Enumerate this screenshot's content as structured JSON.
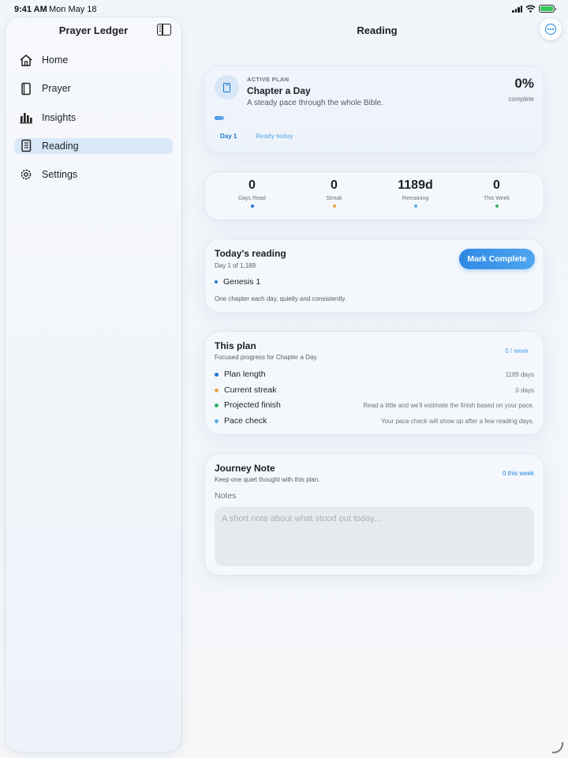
{
  "status_bar": {
    "time": "9:41 AM",
    "date": "Mon May 18"
  },
  "sidebar": {
    "title": "Prayer Ledger",
    "items": [
      {
        "label": "Home",
        "icon": "house-icon",
        "active": false
      },
      {
        "label": "Prayer",
        "icon": "book-icon",
        "active": false
      },
      {
        "label": "Insights",
        "icon": "chart-bars-icon",
        "active": false
      },
      {
        "label": "Reading",
        "icon": "book-pages-icon",
        "active": true
      },
      {
        "label": "Settings",
        "icon": "gear-icon",
        "active": false
      }
    ]
  },
  "header": {
    "title": "Reading"
  },
  "active_plan": {
    "eyebrow": "ACTIVE PLAN",
    "name": "Chapter a Day",
    "description": "A steady pace through the whole Bible.",
    "percent": "0%",
    "percent_label": "complete",
    "progress_fraction": 0,
    "day_chip": "Day 1",
    "ready_chip": "Ready today"
  },
  "stats": [
    {
      "value": "0",
      "label": "Days Read",
      "color": "#1b78d1"
    },
    {
      "value": "0",
      "label": "Streak",
      "color": "#f0a04b"
    },
    {
      "value": "1189d",
      "label": "Remaining",
      "color": "#5ab0e8"
    },
    {
      "value": "0",
      "label": "This Week",
      "color": "#34b36b"
    }
  ],
  "today": {
    "title": "Today's reading",
    "subtitle": "Day 1 of 1,189",
    "button": "Mark Complete",
    "passage": "Genesis 1",
    "note": "One chapter each day, quietly and consistently."
  },
  "this_plan": {
    "title": "This plan",
    "subtitle": "Focused progress for Chapter a Day.",
    "badge": "0 / week",
    "rows": [
      {
        "label": "Plan length",
        "value": "1189 days",
        "color": "#1b78d1"
      },
      {
        "label": "Current streak",
        "value": "0 days",
        "color": "#f0a04b"
      },
      {
        "label": "Projected finish",
        "value": "Read a little and we'll estimate the finish based on your pace.",
        "color": "#34b36b"
      },
      {
        "label": "Pace check",
        "value": "Your pace check will show up after a few reading days.",
        "color": "#5ab0e8"
      }
    ]
  },
  "journey": {
    "title": "Journey Note",
    "subtitle": "Keep one quiet thought with this plan.",
    "badge": "0 this week",
    "notes_label": "Notes",
    "notes_value": "",
    "notes_placeholder": "A short note about what stood out today..."
  }
}
